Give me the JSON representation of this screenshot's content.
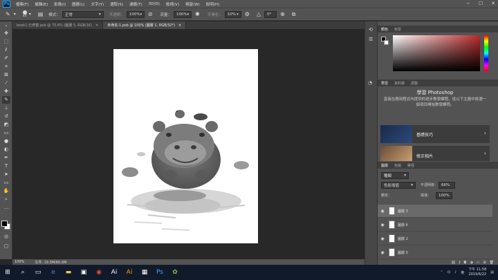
{
  "menubar": {
    "items": [
      "檔案(F)",
      "編輯(E)",
      "影像(I)",
      "圖層(L)",
      "文字(Y)",
      "選取(S)",
      "濾鏡(T)",
      "3D(D)",
      "檢視(V)",
      "視窗(W)",
      "說明(H)"
    ],
    "controls": [
      "−",
      "☐",
      "✕"
    ]
  },
  "options": {
    "brush_size": "40",
    "mode_label": "模式：",
    "mode_value": "正常",
    "opacity_label": "不透明：",
    "opacity_value": "100%",
    "flow_label": "流量：",
    "flow_value": "100%",
    "smoothing_label": "平滑化：",
    "smoothing_value": "10%",
    "angle_value": "0°"
  },
  "tabs": [
    {
      "label": "book1-已修復.psb @ 75.6% (圖層 5, RGB/16)",
      "active": false
    },
    {
      "label": "未命名-1.psb @ 100% (圖層 1, RGB/32*)",
      "active": true
    }
  ],
  "status": {
    "zoom": "100%",
    "doc": "文件: 19.3M/60.0M"
  },
  "color_panel": {
    "tabs": [
      "顏色",
      "色票"
    ],
    "accent": "#b92b2b"
  },
  "learn_panel": {
    "tabs": [
      "學習",
      "資料庫",
      "調整"
    ],
    "title": "學習 Photoshop",
    "desc": "直接在應用程式內提供的逐步教學課程。從以下主題中挑選一個項目開始教學課程。",
    "cards": [
      {
        "label": "基礎技巧"
      },
      {
        "label": "修正相片"
      }
    ]
  },
  "layers_panel": {
    "tabs": [
      "圖層",
      "色版",
      "路徑"
    ],
    "kind": "種類",
    "blend": "色彩增值",
    "opacity_label": "不透明度：",
    "opacity_value": "66%",
    "lock_label": "鎖定：",
    "fill_label": "填滿：",
    "fill_value": "100%",
    "layers": [
      {
        "name": "圖層 3"
      },
      {
        "name": "圖層 6"
      },
      {
        "name": "圖層 2"
      },
      {
        "name": "圖層 0"
      }
    ]
  },
  "taskbar": {
    "time": "下午 11:58",
    "date": "2019/6/22",
    "ime": "英"
  }
}
